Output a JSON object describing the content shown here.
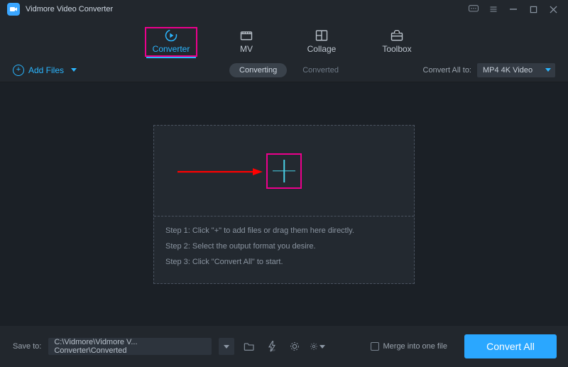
{
  "app": {
    "title": "Vidmore Video Converter"
  },
  "nav": {
    "items": [
      {
        "label": "Converter",
        "active": true
      },
      {
        "label": "MV"
      },
      {
        "label": "Collage"
      },
      {
        "label": "Toolbox"
      }
    ]
  },
  "toolbar": {
    "add_files": "Add Files",
    "tabs": {
      "converting": "Converting",
      "converted": "Converted"
    },
    "convert_all_label": "Convert All to:",
    "format_selected": "MP4 4K Video"
  },
  "dropzone": {
    "step1": "Step 1: Click \"+\" to add files or drag them here directly.",
    "step2": "Step 2: Select the output format you desire.",
    "step3": "Step 3: Click \"Convert All\" to start."
  },
  "footer": {
    "save_label": "Save to:",
    "path": "C:\\Vidmore\\Vidmore V... Converter\\Converted",
    "merge_label": "Merge into one file",
    "convert_button": "Convert All"
  }
}
